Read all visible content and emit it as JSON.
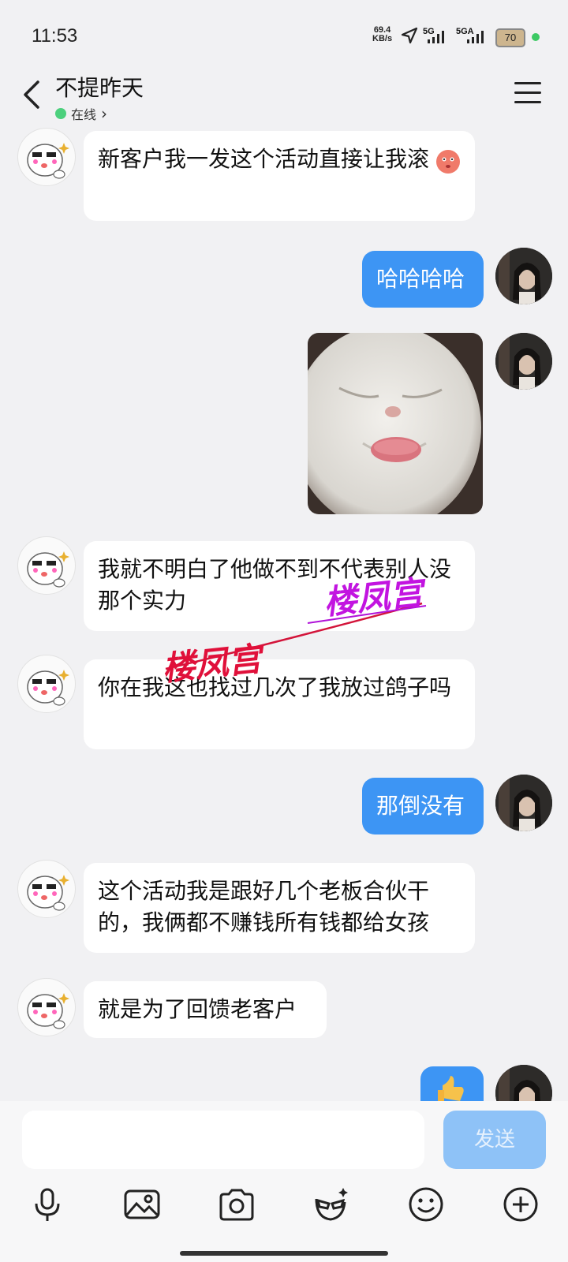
{
  "status": {
    "time": "11:53",
    "speed_value": "69.4",
    "speed_unit": "KB/s",
    "net1": "5G",
    "net2": "5GA",
    "battery": "70"
  },
  "header": {
    "title": "不提昨天",
    "status": "在线",
    "status_chevron": "›"
  },
  "messages": [
    {
      "side": "in",
      "text": "新客户我一发这个活动直接让我滚"
    },
    {
      "side": "out",
      "text": "哈哈哈哈"
    },
    {
      "side": "out",
      "type": "image",
      "text": ""
    },
    {
      "side": "in",
      "text": "我就不明白了他做不到不代表别人没那个实力"
    },
    {
      "side": "in",
      "text": "你在我这也找过几次了我放过鸽子吗"
    },
    {
      "side": "out",
      "text": "那倒没有"
    },
    {
      "side": "in",
      "text": "这个活动我是跟好几个老板合伙干的，我俩都不赚钱所有钱都给女孩"
    },
    {
      "side": "in",
      "text": "就是为了回馈老客户"
    }
  ],
  "watermark": [
    "楼凤宫",
    "楼凤宫"
  ],
  "input": {
    "placeholder": "",
    "send_label": "发送"
  },
  "toolbar": [
    "microphone-icon",
    "image-icon",
    "camera-icon",
    "magic-face-icon",
    "emoji-icon",
    "plus-icon"
  ],
  "colors": {
    "accent": "#3d95f4",
    "send_disabled": "#8ec2f7",
    "online": "#4cd07d",
    "background": "#f1f1f3"
  }
}
